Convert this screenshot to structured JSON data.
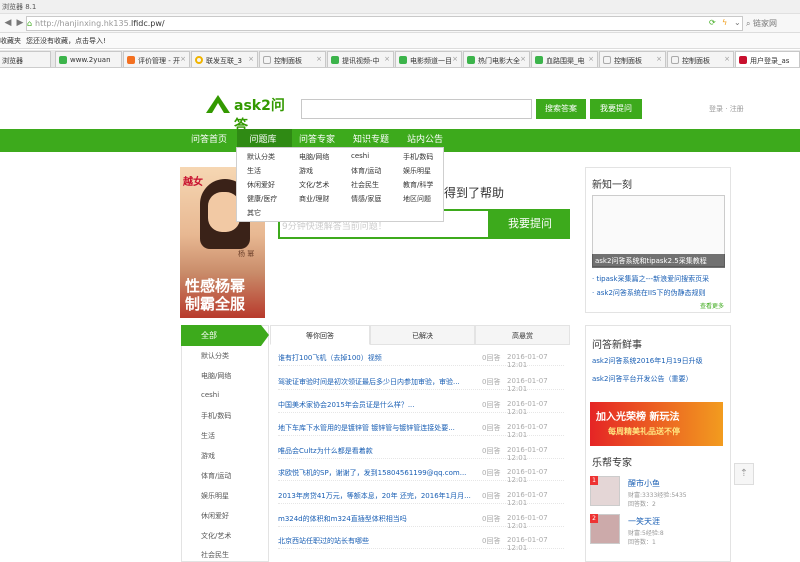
{
  "browser": {
    "title": "浏览器 8.1",
    "url_host": "http://hanjinxing.hk135.",
    "url_domain": "lfidc.pw/",
    "right_link": "链家网",
    "bookmarks": [
      "收藏夹",
      "您还没有收藏，点击导入!"
    ],
    "tabs": [
      "浏览器",
      "www.2yuan",
      "评价管理 - 开",
      "联发互联_3",
      "控制面板",
      "提讯视频-中",
      "电影频道一目",
      "热门电影大全",
      "血路围渠_电",
      "控制面板",
      "控制面板",
      "用户登录_as"
    ]
  },
  "header": {
    "logo_text": "ask2问答",
    "search_placeholder": "",
    "search_answer_btn": "搜索答案",
    "ask_btn": "我要提问",
    "login": "登录",
    "register": "注册"
  },
  "nav": {
    "items": [
      "问答首页",
      "问题库",
      "问答专家",
      "知识专题",
      "站内公告"
    ]
  },
  "dropdown": {
    "col1": [
      "默认分类",
      "生活",
      "休闲爱好",
      "健康/医疗",
      "其它"
    ],
    "col2": [
      "电脑/网络",
      "游戏",
      "文化/艺术",
      "商业/理财"
    ],
    "col3": [
      "ceshi",
      "体育/运动",
      "社会民生",
      "情感/家庭"
    ],
    "col4": [
      "手机/数码",
      "娱乐明星",
      "教育/科学",
      "地区问题"
    ]
  },
  "banner": {
    "tag": "越女",
    "name": "杨 幂",
    "line1": "性感杨幂",
    "line2": "制霸全服"
  },
  "hero": {
    "text": "得到了帮助",
    "input_placeholder": "9分钟快速解答当前问题！",
    "ask_btn": "我要提问"
  },
  "news": {
    "title": "新知一刻",
    "img_caption": "ask2问答系统和tipask2.5采集教程",
    "links": [
      "· tipask采集篇之---新浪爱问搜索页采",
      "· ask2问答系统在IIS下的伪静态规则"
    ],
    "more": "查看更多"
  },
  "categories": {
    "all": "全部",
    "items": [
      "默认分类",
      "电脑/网络",
      "ceshi",
      "手机/数码",
      "生活",
      "游戏",
      "体育/运动",
      "娱乐明星",
      "休闲爱好",
      "文化/艺术",
      "社会民生"
    ]
  },
  "question_tabs": [
    "等你回答",
    "已解决",
    "高悬赏"
  ],
  "questions": [
    {
      "title": "谁有打100飞机（去掉100）视频",
      "answers": "0回答",
      "date": "2016-01-07 12:01"
    },
    {
      "title": "驾驶证审验时间是初次领证最后多少日内参加审验，审验...",
      "answers": "0回答",
      "date": "2016-01-07 12:01"
    },
    {
      "title": "中国美术家协会2015年会员证是什么样？...",
      "answers": "0回答",
      "date": "2016-01-07 12:01"
    },
    {
      "title": "地下车库下水管用的是镀锌管 镀锌管与镀锌管连接处要...",
      "answers": "0回答",
      "date": "2016-01-07 12:01"
    },
    {
      "title": "唯品会Cultz为什么都是看着款",
      "answers": "0回答",
      "date": "2016-01-07 12:01"
    },
    {
      "title": "求欧悦飞机的SP，谢谢了，发到15804561199@qq.com...",
      "answers": "0回答",
      "date": "2016-01-07 12:01"
    },
    {
      "title": "2013年房贷41万元，等额本息，20年 还完，2016年1月月...",
      "answers": "0回答",
      "date": "2016-01-07 12:01"
    },
    {
      "title": "m324d的体积和m324直插型体积相当吗",
      "answers": "0回答",
      "date": "2016-01-07 12:01"
    },
    {
      "title": "北京西站任职过的站长有哪些",
      "answers": "0回答",
      "date": "2016-01-07 12:01"
    }
  ],
  "fresh": {
    "title": "问答新鲜事",
    "links": [
      "ask2问答系统2016年1月19日升级",
      "ask2问答平台开发公告（重要）"
    ]
  },
  "promo": {
    "line1": "加入光荣榜 新玩法",
    "line2": "每周精美礼品送不停"
  },
  "experts": {
    "title": "乐帮专家",
    "list": [
      {
        "rank": "1",
        "name": "醒市小鱼",
        "wealth": "财富:3333经验:5435",
        "answers": "回答数：2"
      },
      {
        "rank": "2",
        "name": "一笑天涯",
        "wealth": "财富:5经验:8",
        "answers": "回答数：1"
      }
    ]
  },
  "colors": {
    "brand": "#3daa1c",
    "link": "#1a5fb4"
  }
}
